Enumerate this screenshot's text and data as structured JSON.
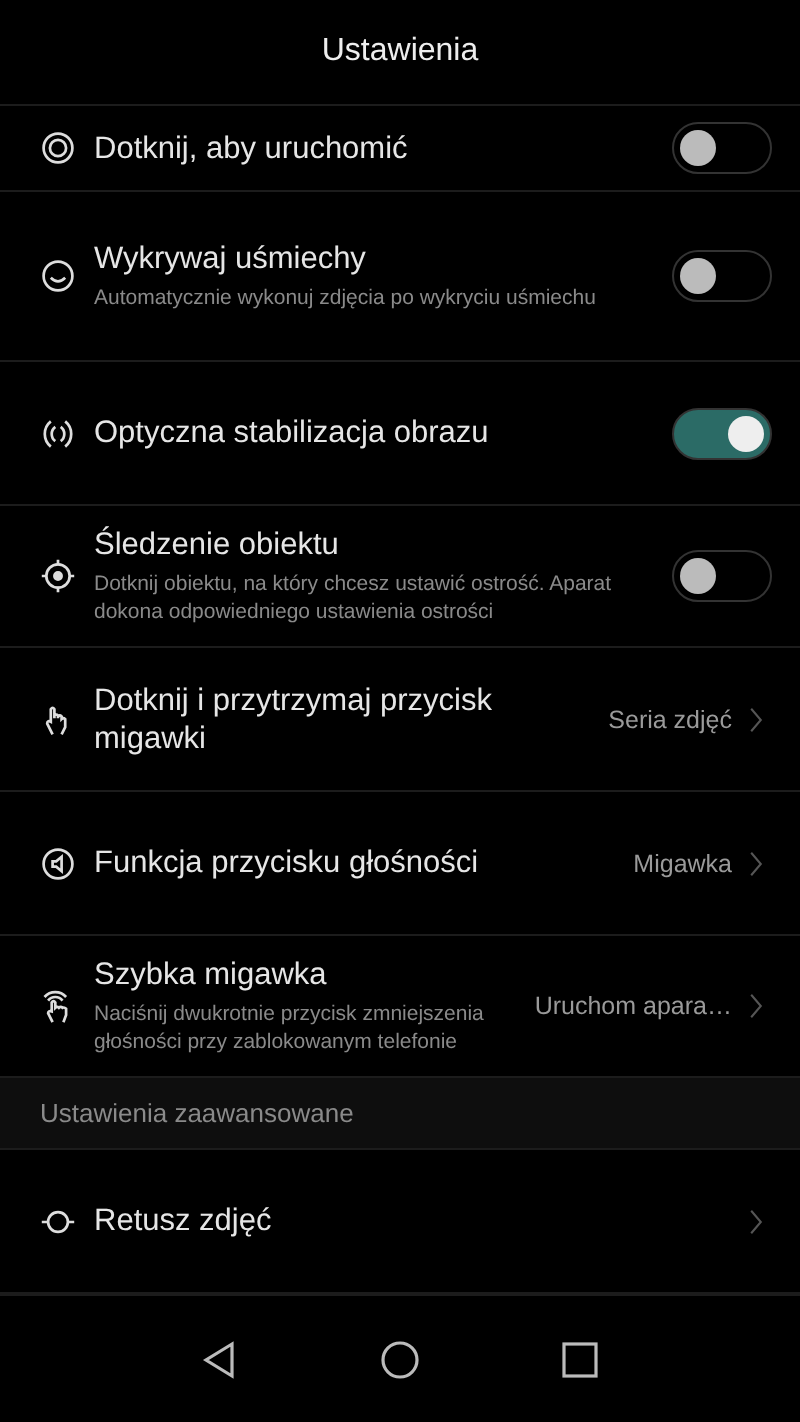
{
  "title": "Ustawienia",
  "items": [
    {
      "kind": "toggle",
      "label": "Dotknij, aby uruchomić",
      "on": false
    },
    {
      "kind": "toggle",
      "label": "Wykrywaj uśmiechy",
      "description": "Automatycznie wykonuj zdjęcia po wykryciu uśmiechu",
      "on": false
    },
    {
      "kind": "toggle",
      "label": "Optyczna stabilizacja obrazu",
      "on": true
    },
    {
      "kind": "toggle",
      "label": "Śledzenie obiektu",
      "description": "Dotknij obiektu, na który chcesz ustawić ostrość. Aparat dokona odpowiedniego ustawienia ostrości",
      "on": false
    },
    {
      "kind": "link",
      "label": "Dotknij i przytrzymaj przycisk migawki",
      "value": "Seria zdjęć"
    },
    {
      "kind": "link",
      "label": "Funkcja przycisku głośności",
      "value": "Migawka"
    },
    {
      "kind": "link",
      "label": "Szybka migawka",
      "description": "Naciśnij dwukrotnie przycisk zmniejszenia głośności przy zablokowanym telefonie",
      "value": "Uruchom apara…"
    },
    {
      "kind": "section",
      "label": "Ustawienia zaawansowane"
    },
    {
      "kind": "link",
      "label": "Retusz zdjęć"
    }
  ]
}
